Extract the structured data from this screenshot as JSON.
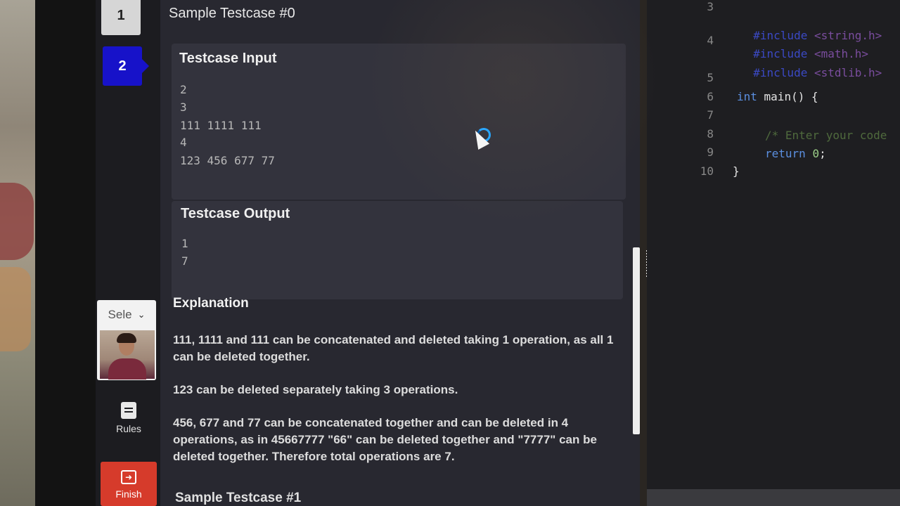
{
  "nav": {
    "questions": [
      "1",
      "2"
    ],
    "camera_select_value": "Sele",
    "rules_label": "Rules",
    "finish_label": "Finish"
  },
  "sample0": {
    "title": "Sample Testcase #0",
    "input_title": "Testcase Input",
    "input_lines": [
      "2",
      "3",
      "111 1111 111",
      "4",
      "123 456 677 77"
    ],
    "output_title": "Testcase Output",
    "output_lines": [
      "1",
      "7"
    ],
    "explanation_title": "Explanation",
    "explanation": [
      "111, 1111 and 111 can be concatenated and deleted taking 1 operation, as all 1 can be deleted together.",
      "123 can be deleted separately taking 3 operations.",
      "456, 677 and 77 can be concatenated together and can be deleted in 4 operations, as in 45667777 \"66\" can be deleted together and \"7777\" can be deleted together. Therefore total operations are 7."
    ]
  },
  "sample1": {
    "title": "Sample Testcase #1"
  },
  "editor": {
    "line_numbers": [
      "3",
      "4",
      "5",
      "6",
      "7",
      "8",
      "9",
      "10"
    ],
    "code": {
      "inc1_kw": "#include",
      "inc1_hdr": "<string.h>",
      "inc2_kw": "#include",
      "inc2_hdr": "<math.h>",
      "inc3_kw": "#include",
      "inc3_hdr": "<stdlib.h>",
      "main_type": "int",
      "main_rest": " main() {",
      "comment": "/* Enter your code",
      "return_kw": "return",
      "return_val": "0",
      "return_end": ";",
      "close_brace": "}"
    }
  },
  "colors": {
    "active_question": "#1712c9",
    "finish_button": "#d63b2b",
    "spinner": "#2aa7ff"
  },
  "icons": [
    "clipboard-icon",
    "exit-icon",
    "chevron-down-icon",
    "mouse-cursor-icon",
    "loading-spinner-icon"
  ]
}
